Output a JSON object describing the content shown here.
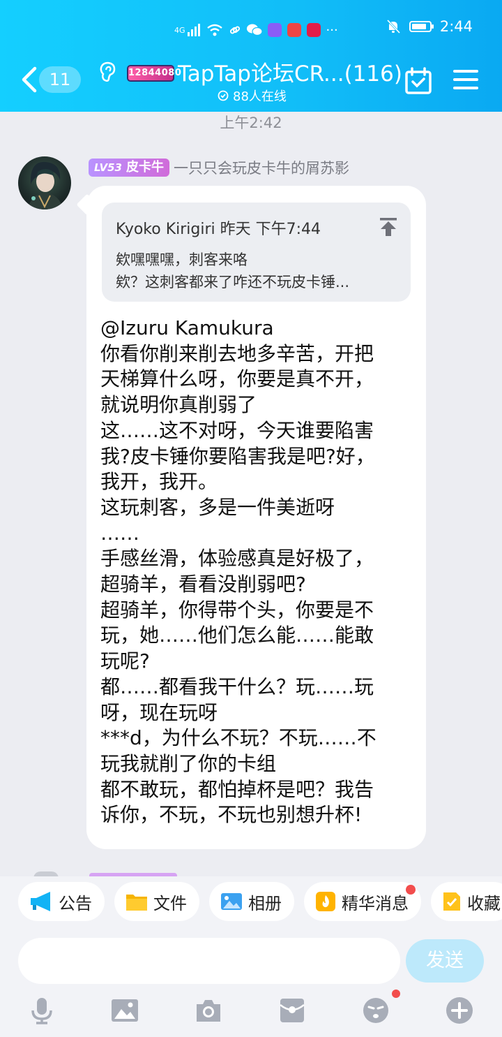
{
  "status_bar": {
    "network": "4G",
    "time": "2:44"
  },
  "header": {
    "unread_count": "11",
    "level_tag": "12844080",
    "title": "TapTap论坛CR...(116)",
    "online": "88人在线"
  },
  "chat": {
    "timestamp": "上午2:42",
    "message": {
      "sender_level": "LV53",
      "sender_title": "皮卡牛",
      "sender_name": "一只只会玩皮卡牛的屑苏影",
      "quote": {
        "author": "Kyoko Kirigiri",
        "time": "昨天 下午7:44",
        "line1": "欸嘿嘿嘿，刺客来咯",
        "line2": "欸？这刺客都来了咋还不玩皮卡锤..."
      },
      "lines": [
        "@Izuru Kamukura",
        "你看你削来削去地多辛苦，开把",
        "天梯算什么呀，你要是真不开，",
        "就说明你真削弱了",
        "这……这不对呀，今天谁要陷害",
        "我?皮卡锤你要陷害我是吧?好，",
        "我开，我开。",
        "这玩刺客，多是一件美逝呀",
        "……",
        "手感丝滑，体验感真是好极了，",
        "超骑羊，看看没削弱吧?",
        "超骑羊，你得带个头，你要是不",
        "玩，她……他们怎么能……能敢",
        "玩呢?",
        "都……都看我干什么？玩……玩",
        "呀，现在玩呀",
        "***d，为什么不玩？不玩……不",
        "玩我就削了你的卡组",
        "都不敢玩，都怕掉杯是吧？我告",
        "诉你，不玩，不玩也别想升杯!"
      ]
    }
  },
  "shortcuts": {
    "announcement": "公告",
    "files": "文件",
    "album": "相册",
    "essence": "精华消息",
    "favorites": "收藏"
  },
  "composer": {
    "value": "",
    "placeholder": "",
    "send_label": "发送"
  },
  "toolbar_icons": [
    "microphone-icon",
    "image-icon",
    "camera-icon",
    "red-packet-icon",
    "emoji-icon",
    "plus-icon"
  ],
  "colors": {
    "header_gradient_start": "#14cfff",
    "header_gradient_end": "#0aa9f2",
    "chat_background": "#ecedf2",
    "sender_badge": "#c07be0",
    "send_button_disabled": "#bde9fb",
    "notification_dot": "#f24d4d",
    "toolbar_icon": "#a8adb8"
  },
  "battery_level": 0.85
}
